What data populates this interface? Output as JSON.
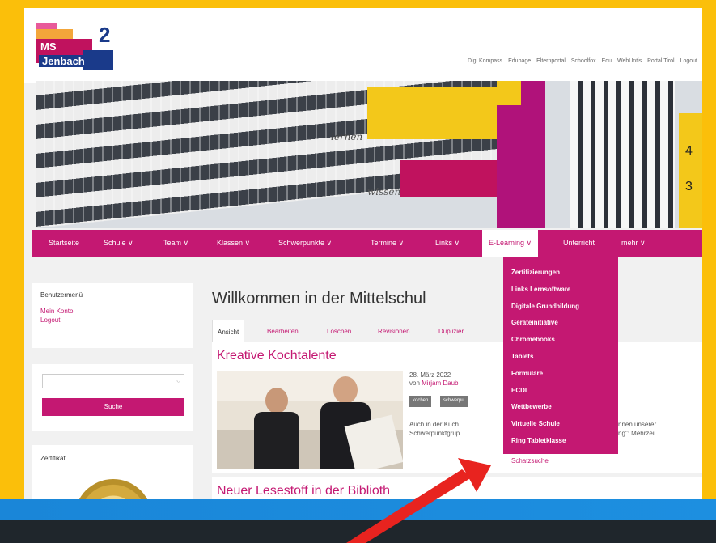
{
  "header": {
    "logo_text_1": "MS",
    "logo_text_2": "Jenbach",
    "logo_number": "2",
    "top_links": [
      "Digi.Kompass",
      "Edupage",
      "Elternportal",
      "Schoolfox",
      "Edu",
      "WebUntis",
      "Portal Tirol",
      "Logout"
    ]
  },
  "hero": {
    "word1": "lernen",
    "word2": "wissen",
    "numbers": [
      "4",
      "3"
    ]
  },
  "nav": {
    "items": [
      "Startseite",
      "Schule ∨",
      "Team ∨",
      "Klassen ∨",
      "Schwerpunkte ∨",
      "Termine ∨",
      "Links ∨",
      "E-Learning ∨",
      "Unterricht",
      "mehr ∨"
    ]
  },
  "dropdown": {
    "items": [
      "Zertifizierungen",
      "Links Lernsoftware",
      "Digitale Grundbildung",
      "Geräteinitiative",
      "Chromebooks",
      "Tablets",
      "Formulare",
      "ECDL",
      "Wettbewerbe",
      "Virtuelle Schule",
      "Ring Tabletklasse",
      "Schatzsuche"
    ],
    "highlighted_index": 11
  },
  "sidebar": {
    "usermenu_title": "Benutzermenü",
    "usermenu_links": [
      "Mein Konto",
      "Logout"
    ],
    "search_button": "Suche",
    "search_placeholder": "",
    "cert_title": "Zertifikat"
  },
  "main": {
    "title": "Willkommen in der Mittelschul",
    "tabs": [
      "Ansicht",
      "Bearbeiten",
      "Löschen",
      "Revisionen",
      "Duplizier"
    ],
    "article1": {
      "heading": "Kreative Kochtalente",
      "date": "28. März 2022",
      "by_prefix": "von",
      "author": "Mirjam Daub",
      "tags": [
        "kochen",
        "schwerpu"
      ],
      "teaser_left_1": "Auch in der Küch",
      "teaser_left_2": "Schwerpunktgrup",
      "teaser_right_1": "nnen unserer",
      "teaser_right_2": "ng\": Mehrzeil"
    },
    "article2": {
      "heading": "Neuer Lesestoff in der Biblioth"
    }
  },
  "colors": {
    "accent": "#c41872",
    "frame": "#fbbf0a",
    "band": "#1d8fe0",
    "arrow": "#e8231f"
  }
}
